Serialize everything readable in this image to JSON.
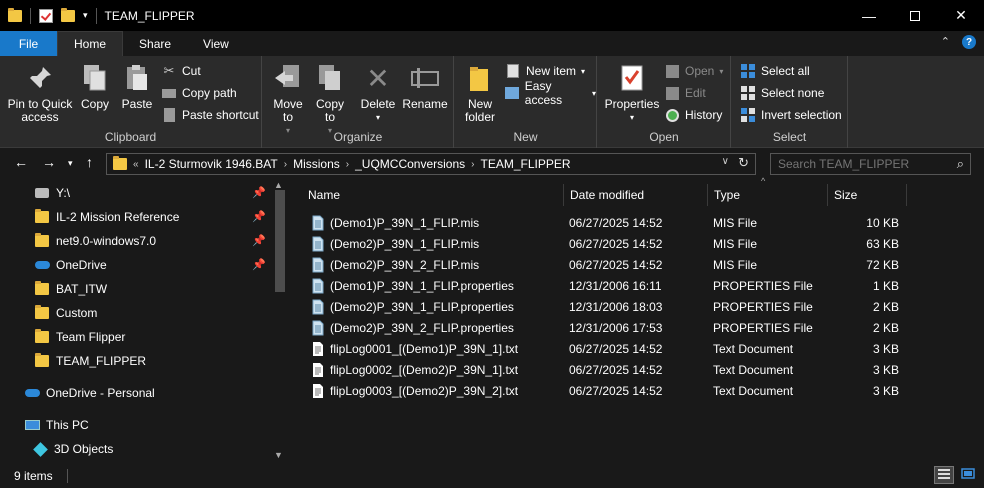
{
  "window": {
    "title": "TEAM_FLIPPER"
  },
  "tabs": [
    {
      "label": "File"
    },
    {
      "label": "Home"
    },
    {
      "label": "Share"
    },
    {
      "label": "View"
    }
  ],
  "ribbon": {
    "clipboard": {
      "label": "Clipboard",
      "pin": "Pin to Quick access",
      "copy": "Copy",
      "paste": "Paste",
      "cut": "Cut",
      "copy_path": "Copy path",
      "paste_shortcut": "Paste shortcut"
    },
    "organize": {
      "label": "Organize",
      "move_to": "Move to",
      "copy_to": "Copy to",
      "delete": "Delete",
      "rename": "Rename"
    },
    "new": {
      "label": "New",
      "new_folder": "New folder",
      "new_item": "New item",
      "easy_access": "Easy access"
    },
    "open": {
      "label": "Open",
      "properties": "Properties",
      "open": "Open",
      "edit": "Edit",
      "history": "History"
    },
    "select": {
      "label": "Select",
      "select_all": "Select all",
      "select_none": "Select none",
      "invert": "Invert selection"
    }
  },
  "address": {
    "overflow": "«",
    "crumbs": [
      "IL-2 Sturmovik 1946.BAT",
      "Missions",
      "_UQMCConversions",
      "TEAM_FLIPPER"
    ]
  },
  "search": {
    "placeholder": "Search TEAM_FLIPPER"
  },
  "sidebar": {
    "items": [
      {
        "label": "Y:\\",
        "icon": "network-drive-icon",
        "pinned": true
      },
      {
        "label": "IL-2 Mission Reference",
        "icon": "folder-icon",
        "pinned": true
      },
      {
        "label": "net9.0-windows7.0",
        "icon": "folder-icon",
        "pinned": true
      },
      {
        "label": "OneDrive",
        "icon": "cloud-icon",
        "pinned": true
      },
      {
        "label": "BAT_ITW",
        "icon": "folder-icon",
        "pinned": false
      },
      {
        "label": "Custom",
        "icon": "folder-icon",
        "pinned": false
      },
      {
        "label": "Team Flipper",
        "icon": "folder-icon",
        "pinned": false
      },
      {
        "label": "TEAM_FLIPPER",
        "icon": "folder-icon",
        "pinned": false
      },
      {
        "label": "OneDrive - Personal",
        "icon": "cloud-icon",
        "pinned": false
      },
      {
        "label": "This PC",
        "icon": "pc-icon",
        "pinned": false
      },
      {
        "label": "3D Objects",
        "icon": "cube-icon",
        "pinned": false
      }
    ]
  },
  "columns": {
    "name": "Name",
    "date": "Date modified",
    "type": "Type",
    "size": "Size"
  },
  "files": [
    {
      "name": "(Demo1)P_39N_1_FLIP.mis",
      "date": "06/27/2025 14:52",
      "type": "MIS File",
      "size": "10 KB",
      "kind": "mis"
    },
    {
      "name": "(Demo2)P_39N_1_FLIP.mis",
      "date": "06/27/2025 14:52",
      "type": "MIS File",
      "size": "63 KB",
      "kind": "mis"
    },
    {
      "name": "(Demo2)P_39N_2_FLIP.mis",
      "date": "06/27/2025 14:52",
      "type": "MIS File",
      "size": "72 KB",
      "kind": "mis"
    },
    {
      "name": "(Demo1)P_39N_1_FLIP.properties",
      "date": "12/31/2006 16:11",
      "type": "PROPERTIES File",
      "size": "1 KB",
      "kind": "mis"
    },
    {
      "name": "(Demo2)P_39N_1_FLIP.properties",
      "date": "12/31/2006 18:03",
      "type": "PROPERTIES File",
      "size": "2 KB",
      "kind": "mis"
    },
    {
      "name": "(Demo2)P_39N_2_FLIP.properties",
      "date": "12/31/2006 17:53",
      "type": "PROPERTIES File",
      "size": "2 KB",
      "kind": "mis"
    },
    {
      "name": "flipLog0001_[(Demo1)P_39N_1].txt",
      "date": "06/27/2025 14:52",
      "type": "Text Document",
      "size": "3 KB",
      "kind": "txt"
    },
    {
      "name": "flipLog0002_[(Demo2)P_39N_1].txt",
      "date": "06/27/2025 14:52",
      "type": "Text Document",
      "size": "3 KB",
      "kind": "txt"
    },
    {
      "name": "flipLog0003_[(Demo2)P_39N_2].txt",
      "date": "06/27/2025 14:52",
      "type": "Text Document",
      "size": "3 KB",
      "kind": "txt"
    }
  ],
  "status": {
    "count": "9 items"
  },
  "colors": {
    "accent": "#1979ca",
    "folder": "#f3c744",
    "onedrive": "#2b88d8"
  }
}
